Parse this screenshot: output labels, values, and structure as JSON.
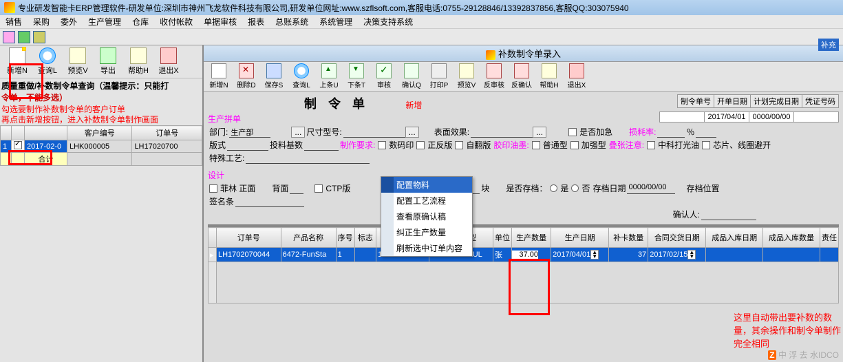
{
  "app": {
    "title": "专业研发智能卡ERP管理软件-研发单位:深圳市神州飞龙软件科技有限公司,研发单位网址:www.szflsoft.com,客服电话:0755-29128846/13392837856,客服QQ:303075940"
  },
  "menu": [
    "销售",
    "采购",
    "委外",
    "生产管理",
    "仓库",
    "收付帐款",
    "单据审核",
    "报表",
    "总账系统",
    "系统管理",
    "决策支持系统"
  ],
  "left_toolbar": [
    {
      "label": "新增N"
    },
    {
      "label": "查询L"
    },
    {
      "label": "预览V"
    },
    {
      "label": "导出"
    },
    {
      "label": "帮助H"
    },
    {
      "label": "退出X"
    }
  ],
  "left": {
    "title": "质量重做/补数制令单查询（温馨提示：只能打",
    "title2": "令单，不能多选）",
    "anno1": "勾选要制作补数制令单的客户订单",
    "anno2": "再点击新增按钮，进入补数制令单制作画面",
    "cols": [
      "",
      "",
      "",
      "客户编号",
      "订单号"
    ],
    "row": {
      "seq": "1",
      "chk": true,
      "date": "2017-02-0",
      "cust": "LHK000005",
      "order": "LH17020700"
    },
    "sum": "合计"
  },
  "right": {
    "win_title": "补数制令单录入",
    "toolbar": [
      "新增N",
      "删除D",
      "保存S",
      "查询L",
      "上条U",
      "下条T",
      "审核",
      "确认Q",
      "打印P",
      "预览V",
      "反审核",
      "反确认",
      "帮助H",
      "退出X"
    ],
    "form_title": "制 令 单",
    "tag": "新增",
    "hdr": {
      "f1": "制令单号",
      "f2": "开单日期",
      "v2": "2017/04/01",
      "f3": "计划完成日期",
      "v3": "0000/00/00",
      "f4": "凭证号码"
    },
    "grp1": "生产拼单",
    "row1": {
      "dept_l": "部门:",
      "dept_v": "生产部",
      "size_l": "尺寸型号:",
      "face_l": "表面效果:",
      "jia_l": "是否加急",
      "loss_l": "损耗率:",
      "loss_u": "％"
    },
    "row2": {
      "ver_l": "版式",
      "v2": "投料基数",
      "v3": "制作要求:",
      "c1": "数码印",
      "c2": "正反版",
      "c3": "自翻版",
      "m1": "胶印油墨:",
      "c4": "普通型",
      "c5": "加强型",
      "m2": "叠张注意:",
      "c6": "中科打光油",
      "c7": "芯片、线圈避开"
    },
    "row3": {
      "sp_l": "特殊工艺:"
    },
    "grp2": "设计",
    "row4": {
      "c1": "菲林 正面",
      "l2": "背面",
      "c3": "CTP版",
      "l4": "版",
      "l5": "块",
      "l6": "是否存档：",
      "o1": "是",
      "o2": "否",
      "l7": "存档日期",
      "v7": "0000/00/00",
      "l8": "存档位置"
    },
    "row5": {
      "l": "签名条"
    },
    "row6": {
      "l": "确认人:"
    },
    "red_hint": "这里自动带出要补数的数量，其余操作和制令单制作完全相同",
    "ctx": [
      "配置物料",
      "配置工艺流程",
      "查看原确认稿",
      "纠正生产数量",
      "刷新选中订单内容"
    ],
    "grid": {
      "cols": [
        "订单号",
        "产品名称",
        "序号",
        "标志",
        "料号",
        "规格类型",
        "单位",
        "生产数量",
        "生产日期",
        "补卡数量",
        "合同交货日期",
        "成品入库日期",
        "成品入库数量",
        "责任"
      ],
      "row": {
        "order": "LH1702070044",
        "prod": "6472-FunSta",
        "seq": "1",
        "mark": "",
        "mat": "1702070044",
        "spec": "FM11RF005UL",
        "unit": "张",
        "qty": "37.00",
        "date": "2017/04/01",
        "rep": "37",
        "deliv": "2017/02/15"
      }
    }
  },
  "corner": "补充",
  "wm": "中 浮 去 水IDCO"
}
